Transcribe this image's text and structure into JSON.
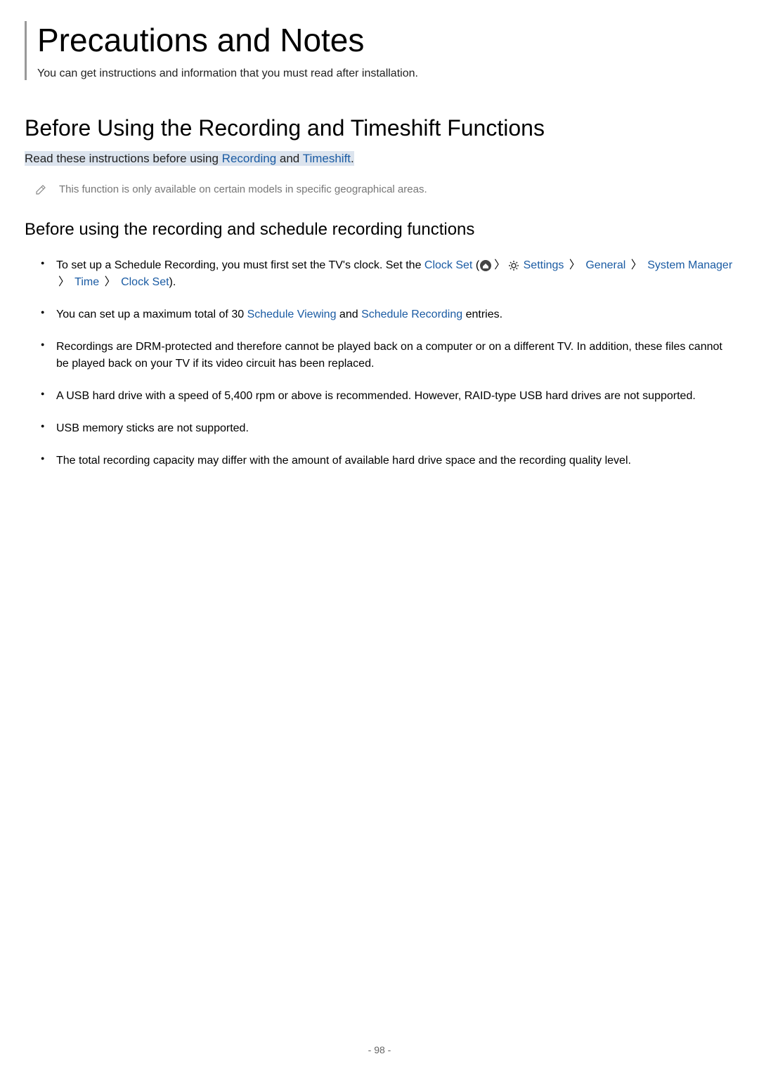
{
  "header": {
    "title": "Precautions and Notes",
    "subtitle": "You can get instructions and information that you must read after installation."
  },
  "section": {
    "heading": "Before Using the Recording and Timeshift Functions",
    "intro_pre": "Read these instructions before using ",
    "intro_link1": "Recording",
    "intro_mid": " and ",
    "intro_link2": "Timeshift",
    "intro_post": ".",
    "note": "This function is only available on certain models in specific geographical areas."
  },
  "subsection": {
    "heading": "Before using the recording and schedule recording functions"
  },
  "bullets": {
    "b1_pre": "To set up a Schedule Recording, you must first set the TV's clock. Set the ",
    "b1_clockset": "Clock Set",
    "b1_paren_open": " (",
    "b1_settings": " Settings",
    "b1_general": "General",
    "b1_sm": "System Manager",
    "b1_time": "Time",
    "b1_clockset2": "Clock Set",
    "b1_close": ").",
    "b2_pre": "You can set up a maximum total of 30 ",
    "b2_sv": "Schedule Viewing",
    "b2_mid": " and ",
    "b2_sr": "Schedule Recording",
    "b2_post": " entries.",
    "b3": "Recordings are DRM-protected and therefore cannot be played back on a computer or on a different TV. In addition, these files cannot be played back on your TV if its video circuit has been replaced.",
    "b4": "A USB hard drive with a speed of 5,400 rpm or above is recommended. However, RAID-type USB hard drives are not supported.",
    "b5": "USB memory sticks are not supported.",
    "b6": "The total recording capacity may differ with the amount of available hard drive space and the recording quality level."
  },
  "footer": {
    "page": "- 98 -"
  }
}
